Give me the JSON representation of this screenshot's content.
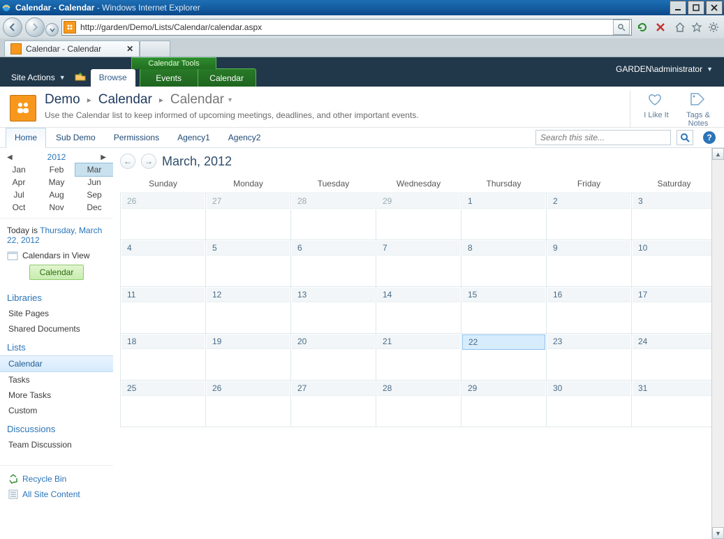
{
  "window": {
    "title_prefix": "Calendar - Calendar",
    "title_suffix": " - Windows Internet Explorer",
    "url": "http://garden/Demo/Lists/Calendar/calendar.aspx",
    "tab_label": "Calendar - Calendar"
  },
  "ribbon": {
    "site_actions": "Site Actions",
    "browse": "Browse",
    "contextual_label": "Calendar Tools",
    "events": "Events",
    "calendar": "Calendar",
    "user": "GARDEN\\administrator"
  },
  "page": {
    "site": "Demo",
    "list": "Calendar",
    "view": "Calendar",
    "description": "Use the Calendar list to keep informed of upcoming meetings, deadlines, and other important events."
  },
  "topnav": {
    "links": [
      "Home",
      "Sub Demo",
      "Permissions",
      "Agency1",
      "Agency2"
    ],
    "search_placeholder": "Search this site..."
  },
  "social": {
    "like": "I Like It",
    "tags": "Tags &\nNotes"
  },
  "datepicker": {
    "year": "2012",
    "months": [
      "Jan",
      "Feb",
      "Mar",
      "Apr",
      "May",
      "Jun",
      "Jul",
      "Aug",
      "Sep",
      "Oct",
      "Nov",
      "Dec"
    ],
    "selected_index": 2,
    "today_prefix": "Today is ",
    "today_link": "Thursday, March 22, 2012"
  },
  "calendars_in_view": {
    "label": "Calendars in View",
    "button": "Calendar"
  },
  "quicklaunch": {
    "libraries_head": "Libraries",
    "libraries": [
      "Site Pages",
      "Shared Documents"
    ],
    "lists_head": "Lists",
    "lists": [
      "Calendar",
      "Tasks",
      "More Tasks",
      "Custom"
    ],
    "discussions_head": "Discussions",
    "discussions": [
      "Team Discussion"
    ],
    "recycle": "Recycle Bin",
    "all_content": "All Site Content"
  },
  "calendar": {
    "title": "March, 2012",
    "day_headers": [
      "Sunday",
      "Monday",
      "Tuesday",
      "Wednesday",
      "Thursday",
      "Friday",
      "Saturday"
    ],
    "weeks": [
      [
        {
          "n": "26",
          "o": true
        },
        {
          "n": "27",
          "o": true
        },
        {
          "n": "28",
          "o": true
        },
        {
          "n": "29",
          "o": true
        },
        {
          "n": "1"
        },
        {
          "n": "2"
        },
        {
          "n": "3"
        }
      ],
      [
        {
          "n": "4"
        },
        {
          "n": "5"
        },
        {
          "n": "6"
        },
        {
          "n": "7"
        },
        {
          "n": "8"
        },
        {
          "n": "9"
        },
        {
          "n": "10"
        }
      ],
      [
        {
          "n": "11"
        },
        {
          "n": "12"
        },
        {
          "n": "13"
        },
        {
          "n": "14"
        },
        {
          "n": "15"
        },
        {
          "n": "16"
        },
        {
          "n": "17"
        }
      ],
      [
        {
          "n": "18"
        },
        {
          "n": "19"
        },
        {
          "n": "20"
        },
        {
          "n": "21"
        },
        {
          "n": "22",
          "t": true
        },
        {
          "n": "23"
        },
        {
          "n": "24"
        }
      ],
      [
        {
          "n": "25"
        },
        {
          "n": "26"
        },
        {
          "n": "27"
        },
        {
          "n": "28"
        },
        {
          "n": "29"
        },
        {
          "n": "30"
        },
        {
          "n": "31"
        }
      ]
    ]
  }
}
